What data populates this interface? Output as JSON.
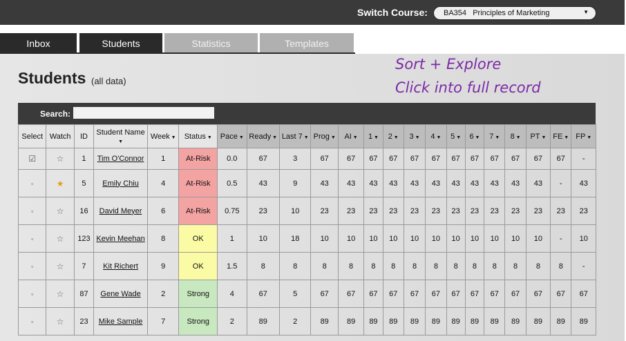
{
  "header": {
    "switch_label": "Switch Course:",
    "course_value": "BA354   Principles of Marketing"
  },
  "tabs": [
    "Inbox",
    "Students",
    "Statistics",
    "Templates"
  ],
  "page": {
    "title": "Students",
    "subtitle": "(all data)",
    "annotation_line1": "Sort + Explore",
    "annotation_line2": "Click into full record",
    "search_label": "Search:"
  },
  "columns": [
    "Select",
    "Watch",
    "ID",
    "Student Name",
    "Week",
    "Status",
    "Pace",
    "Ready",
    "Last 7",
    "Prog",
    "AI",
    "1",
    "2",
    "3",
    "4",
    "5",
    "6",
    "7",
    "8",
    "PT",
    "FE",
    "FP"
  ],
  "students": [
    {
      "selected": true,
      "watched": false,
      "id": "1",
      "name": "Tim O'Connor",
      "week": "1",
      "status": "At-Risk",
      "pace": "0.0",
      "ready": "67",
      "last7": "3",
      "prog": "67",
      "ai": "67",
      "m1": "67",
      "m2": "67",
      "m3": "67",
      "m4": "67",
      "m5": "67",
      "m6": "67",
      "m7": "67",
      "m8": "67",
      "pt": "67",
      "fe": "67",
      "fp": "-"
    },
    {
      "selected": false,
      "watched": true,
      "id": "5",
      "name": "Emily Chiu",
      "week": "4",
      "status": "At-Risk",
      "pace": "0.5",
      "ready": "43",
      "last7": "9",
      "prog": "43",
      "ai": "43",
      "m1": "43",
      "m2": "43",
      "m3": "43",
      "m4": "43",
      "m5": "43",
      "m6": "43",
      "m7": "43",
      "m8": "43",
      "pt": "43",
      "fe": "-",
      "fp": "43"
    },
    {
      "selected": false,
      "watched": false,
      "id": "16",
      "name": "David Meyer",
      "week": "6",
      "status": "At-Risk",
      "pace": "0.75",
      "ready": "23",
      "last7": "10",
      "prog": "23",
      "ai": "23",
      "m1": "23",
      "m2": "23",
      "m3": "23",
      "m4": "23",
      "m5": "23",
      "m6": "23",
      "m7": "23",
      "m8": "23",
      "pt": "23",
      "fe": "23",
      "fp": "23"
    },
    {
      "selected": false,
      "watched": false,
      "id": "123",
      "name": "Kevin Meehan",
      "week": "8",
      "status": "OK",
      "pace": "1",
      "ready": "10",
      "last7": "18",
      "prog": "10",
      "ai": "10",
      "m1": "10",
      "m2": "10",
      "m3": "10",
      "m4": "10",
      "m5": "10",
      "m6": "10",
      "m7": "10",
      "m8": "10",
      "pt": "10",
      "fe": "-",
      "fp": "10"
    },
    {
      "selected": false,
      "watched": false,
      "id": "7",
      "name": "Kit Richert",
      "week": "9",
      "status": "OK",
      "pace": "1.5",
      "ready": "8",
      "last7": "8",
      "prog": "8",
      "ai": "8",
      "m1": "8",
      "m2": "8",
      "m3": "8",
      "m4": "8",
      "m5": "8",
      "m6": "8",
      "m7": "8",
      "m8": "8",
      "pt": "8",
      "fe": "8",
      "fp": "-"
    },
    {
      "selected": false,
      "watched": false,
      "id": "87",
      "name": "Gene Wade",
      "week": "2",
      "status": "Strong",
      "pace": "4",
      "ready": "67",
      "last7": "5",
      "prog": "67",
      "ai": "67",
      "m1": "67",
      "m2": "67",
      "m3": "67",
      "m4": "67",
      "m5": "67",
      "m6": "67",
      "m7": "67",
      "m8": "67",
      "pt": "67",
      "fe": "67",
      "fp": "67"
    },
    {
      "selected": false,
      "watched": false,
      "id": "23",
      "name": "Mike Sample",
      "week": "7",
      "status": "Strong",
      "pace": "2",
      "ready": "89",
      "last7": "2",
      "prog": "89",
      "ai": "89",
      "m1": "89",
      "m2": "89",
      "m3": "89",
      "m4": "89",
      "m5": "89",
      "m6": "89",
      "m7": "89",
      "m8": "89",
      "pt": "89",
      "fe": "89",
      "fp": "89"
    }
  ],
  "status_colors": {
    "At-Risk": "#f4a3a3",
    "OK": "#fbfba6",
    "Strong": "#c8e8c0"
  },
  "icons": {
    "sort": "caret-down-icon",
    "watch": "star-icon",
    "select": "checkbox-icon"
  }
}
